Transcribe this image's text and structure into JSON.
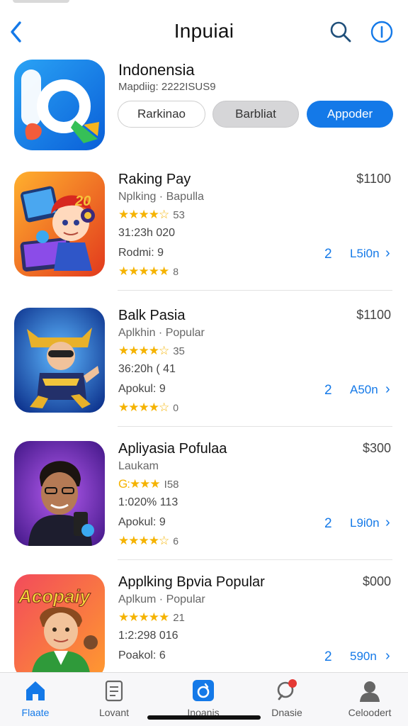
{
  "nav": {
    "title": "Inpuiai",
    "back_icon": "chevron-left-icon",
    "search_icon": "search-icon",
    "info_icon": "info-icon"
  },
  "header": {
    "title": "Indonensia",
    "subtitle": "Mapdiig: 2222ISUS9",
    "buttons": [
      "Rarkinao",
      "Barbliat",
      "Appoder"
    ]
  },
  "apps": [
    {
      "name": "Raking Pay",
      "category": "Nplking · Bapulla",
      "stars": "★★★★☆",
      "rating": "53",
      "meta": "31:23h 020",
      "sub": "Rodmi: 9",
      "stars2": "★★★★★",
      "rating2": "8",
      "price": "$1100",
      "count": "2",
      "link": "L5i0n"
    },
    {
      "name": "Balk Pasia",
      "category": "Aplkhin · Popular",
      "stars": "★★★★☆",
      "rating": "35",
      "meta": "36:20h ( 41",
      "sub": "Apokul: 9",
      "stars2": "★★★★☆",
      "rating2": "0",
      "price": "$1100",
      "count": "2",
      "link": "A50n"
    },
    {
      "name": "Apliyasia Pofulaa",
      "category": "Laukam",
      "stars": "G:★★★",
      "rating": "I58",
      "meta": "1:020% 113",
      "sub": "Apokul: 9",
      "stars2": "★★★★☆",
      "rating2": "6",
      "price": "$300",
      "count": "2",
      "link": "L9i0n"
    },
    {
      "name": "Applking Bpvia Popular",
      "category": "Aplkum · Popular",
      "stars": "★★★★★",
      "rating": "21",
      "meta": "1:2:298 016",
      "sub": "Poakol: 6",
      "stars2": "",
      "rating2": "",
      "price": "$000",
      "count": "2",
      "link": "590n"
    }
  ],
  "tabs": [
    {
      "label": "Flaate",
      "icon": "home-icon",
      "active": true
    },
    {
      "label": "Lovant",
      "icon": "document-icon",
      "active": false
    },
    {
      "label": "Inoanis",
      "icon": "app-store-icon",
      "active": false
    },
    {
      "label": "Dnasie",
      "icon": "search-notification-icon",
      "active": false
    },
    {
      "label": "Celoodert",
      "icon": "profile-icon",
      "active": false
    }
  ],
  "colors": {
    "accent": "#1479e8",
    "star": "#f5b301",
    "notification": "#e53935"
  }
}
